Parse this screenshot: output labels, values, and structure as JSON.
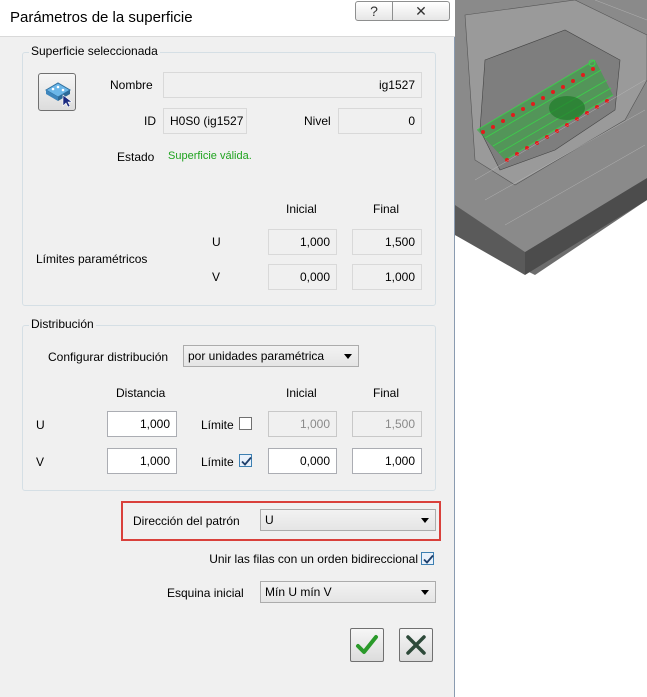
{
  "dialog": {
    "title": "Parámetros de la superficie",
    "help_glyph": "?",
    "close_glyph": "✕"
  },
  "surface": {
    "group_title": "Superficie seleccionada",
    "name_label": "Nombre",
    "name_value": "ig1527",
    "id_label": "ID",
    "id_value": "H0S0 (ig1527",
    "level_label": "Nivel",
    "level_value": "0",
    "status_label": "Estado",
    "status_value": "Superficie válida.",
    "col_initial": "Inicial",
    "col_final": "Final",
    "limits_label": "Límites paramétricos",
    "u_label": "U",
    "v_label": "V",
    "u_initial": "1,000",
    "u_final": "1,500",
    "v_initial": "0,000",
    "v_final": "1,000"
  },
  "distribution": {
    "group_title": "Distribución",
    "config_label": "Configurar distribución",
    "config_value": "por unidades paramétrica",
    "col_distance": "Distancia",
    "col_initial": "Inicial",
    "col_final": "Final",
    "u_label": "U",
    "v_label": "V",
    "u_distance": "1,000",
    "v_distance": "1,000",
    "limit_label": "Límite",
    "u_limit_checked": false,
    "v_limit_checked": true,
    "u_initial": "1,000",
    "u_final": "1,500",
    "v_initial": "0,000",
    "v_final": "1,000"
  },
  "pattern": {
    "direction_label": "Dirección del patrón",
    "direction_value": "U",
    "bidirectional_label": "Unir las filas con un orden bidireccional",
    "bidirectional_checked": true,
    "start_corner_label": "Esquina inicial",
    "start_corner_value": "Mín U mín V"
  },
  "buttons": {
    "ok_icon": "checkmark-icon",
    "cancel_icon": "x-icon"
  },
  "colors": {
    "highlight_border": "#d9403b",
    "status_valid": "#1fa31f",
    "ok_green": "#2a9a2a",
    "cancel_dark": "#2e4a3a"
  }
}
